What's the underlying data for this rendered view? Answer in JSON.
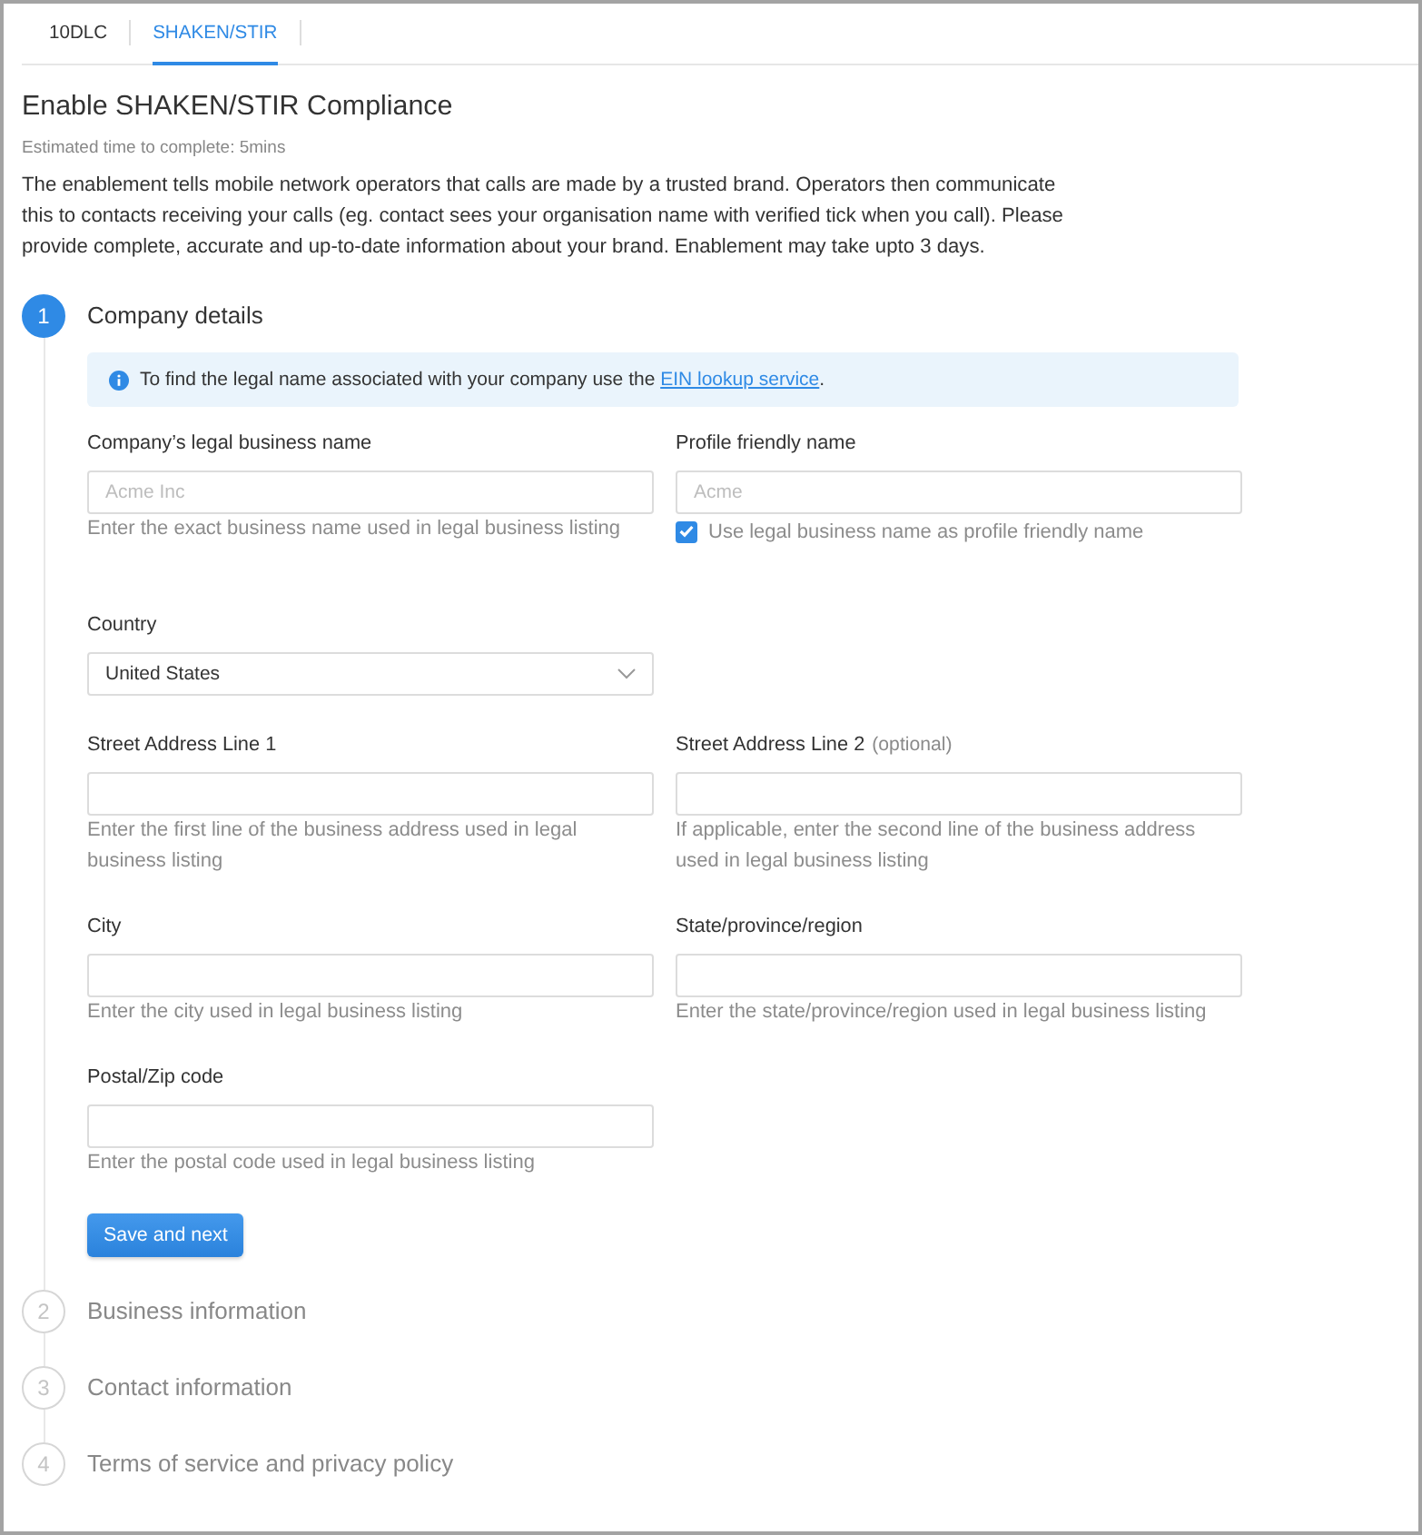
{
  "tabs": [
    {
      "label": "10DLC",
      "selected": false
    },
    {
      "label": "SHAKEN/STIR",
      "selected": true
    }
  ],
  "header": {
    "title": "Enable SHAKEN/STIR Compliance",
    "estimate": "Estimated time to complete: 5mins",
    "description": "The enablement tells mobile network operators that calls are made by a trusted brand. Operators then communicate this to contacts receiving your calls (eg. contact sees your organisation name with verified tick when you call). Please provide complete, accurate and up-to-date information about your brand. Enablement may take upto 3 days."
  },
  "steps": [
    {
      "number": "1",
      "title": "Company details",
      "active": true,
      "form": {
        "info": {
          "before": "To find the legal name associated with your company use the ",
          "link": "EIN lookup service",
          "after": "."
        },
        "rows": [
          [
            {
              "kind": "text",
              "label": "Company’s legal business name",
              "placeholder": "Acme Inc",
              "hint": "Enter the exact business name used in legal business listing"
            },
            {
              "kind": "text",
              "label": "Profile friendly name",
              "placeholder": "Acme",
              "checkbox": {
                "label": "Use legal business name as profile friendly name",
                "checked": true
              }
            }
          ],
          [
            {
              "kind": "select",
              "label": "Country",
              "value": "United States"
            }
          ],
          [
            {
              "kind": "text",
              "label": "Street Address Line 1",
              "hint": "Enter the first line of the business address used in legal business listing"
            },
            {
              "kind": "text",
              "label": "Street Address Line 2",
              "note": "(optional)",
              "hint": "If applicable, enter the second line of the business address used in legal business listing"
            }
          ],
          [
            {
              "kind": "text",
              "label": "City",
              "hint": "Enter the city used in legal business listing"
            },
            {
              "kind": "text",
              "label": "State/province/region",
              "hint": "Enter the state/province/region used in legal business listing"
            }
          ],
          [
            {
              "kind": "text",
              "label": "Postal/Zip code",
              "hint": "Enter the postal code used in legal business listing"
            }
          ]
        ],
        "submit": "Save and next"
      }
    },
    {
      "number": "2",
      "title": "Business information",
      "active": false
    },
    {
      "number": "3",
      "title": "Contact information",
      "active": false
    },
    {
      "number": "4",
      "title": "Terms of service and privacy policy",
      "active": false
    }
  ]
}
